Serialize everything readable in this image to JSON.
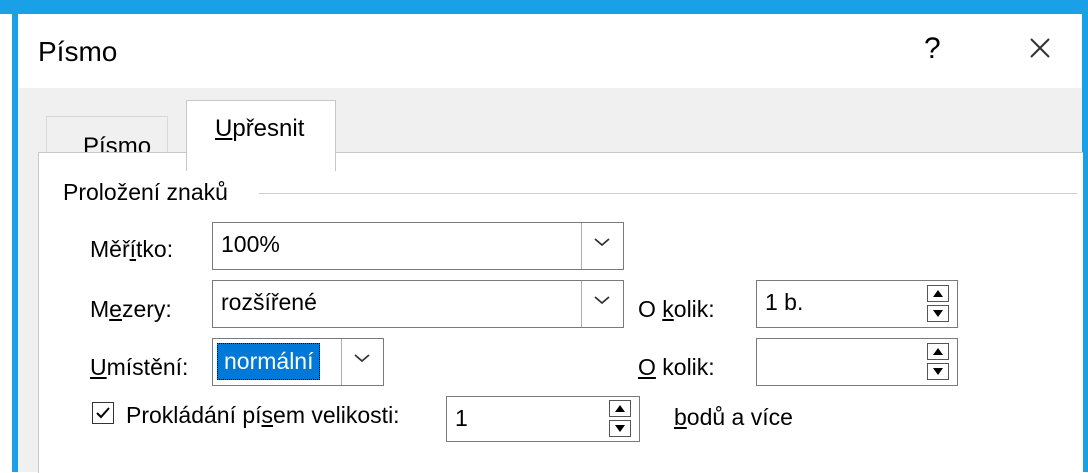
{
  "dialog": {
    "title": "Písmo",
    "help_label": "?",
    "close_icon": "close-icon"
  },
  "tabs": [
    {
      "label_pre": "Pís",
      "label_mn": "m",
      "label_post": "o",
      "active": false
    },
    {
      "label_pre": "",
      "label_mn": "U",
      "label_post": "přesnit",
      "active": true
    }
  ],
  "section": {
    "title": "Proložení znaků"
  },
  "scale": {
    "label_pre": "Měř",
    "label_mn": "í",
    "label_post": "tko:",
    "value": "100%"
  },
  "spacing": {
    "label_pre": "M",
    "label_mn": "e",
    "label_post": "zery:",
    "value": "rozšířené",
    "by_label_pre": "O ",
    "by_label_mn": "k",
    "by_label_post": "olik:",
    "by_value": "1 b."
  },
  "position": {
    "label_pre": "",
    "label_mn": "U",
    "label_post": "místění:",
    "value": "normální",
    "by_label_pre": "",
    "by_label_mn": "O",
    "by_label_post": " kolik:",
    "by_value": ""
  },
  "kerning": {
    "checked": true,
    "label_pre": "Prokládání pí",
    "label_mn": "s",
    "label_post": "em velikosti:",
    "value": "1",
    "suffix_pre": "",
    "suffix_mn": "b",
    "suffix_post": "odů a více"
  },
  "colors": {
    "frame": "#1aa0e6",
    "selection": "#0078d7"
  }
}
